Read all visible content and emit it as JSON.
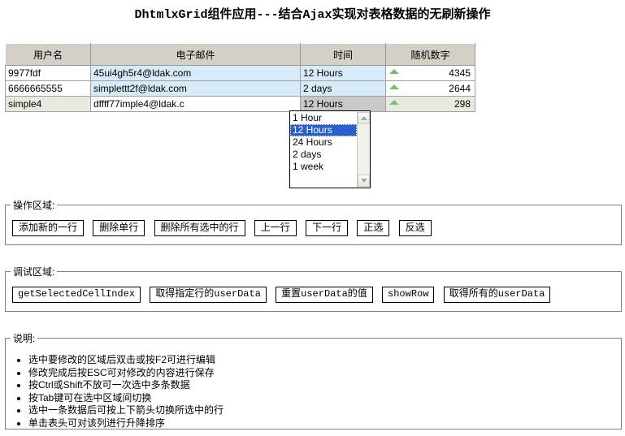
{
  "page": {
    "title": "DhtmlxGrid组件应用---结合Ajax实现对表格数据的无刷新操作"
  },
  "grid": {
    "columns": [
      "用户名",
      "电子邮件",
      "时间",
      "随机数字"
    ],
    "rows": [
      {
        "user": "9977fdf",
        "email": "45ui4gh5r4@ldak.com",
        "time": "12 Hours",
        "number": "4345",
        "sort_icon": "up-arrow-icon",
        "state": "blue"
      },
      {
        "user": "6666665555",
        "email": "simplettt2f@ldak.com",
        "time": "2 days",
        "number": "2644",
        "sort_icon": "up-arrow-icon",
        "state": "blue"
      },
      {
        "user": "simple4",
        "email": "dffff77imple4@ldak.c",
        "time": "12 Hours",
        "number": "298",
        "sort_icon": "up-arrow-icon",
        "state": "selected"
      }
    ]
  },
  "dropdown": {
    "options": [
      "1 Hour",
      "12 Hours",
      "24 Hours",
      "2 days",
      "1 week"
    ],
    "selected": "12 Hours",
    "scroll_up_icon": "chevron-up-icon",
    "scroll_down_icon": "chevron-down-icon"
  },
  "operations": {
    "legend": "操作区域:",
    "buttons": [
      "添加新的一行",
      "删除单行",
      "删除所有选中的行",
      "上一行",
      "下一行",
      "正选",
      "反选"
    ]
  },
  "debug": {
    "legend": "调试区域:",
    "buttons": [
      "getSelectedCellIndex",
      "取得指定行的userData",
      "重置userData的值",
      "showRow",
      "取得所有的userData"
    ]
  },
  "help": {
    "legend": "说明:",
    "items": [
      "选中要修改的区域后双击或按F2可进行编辑",
      "修改完成后按ESC可对修改的内容进行保存",
      "按Ctrl或Shift不放可一次选中多条数据",
      "按Tab键可在选中区域间切换",
      "选中一条数据后可按上下箭头切换所选中的行",
      "单击表头可对该列进行升降排序"
    ]
  },
  "colors": {
    "header_bg": "#d4d0c8",
    "row_blue": "#d6ebf7",
    "row_selected": "#e9e9e0",
    "active_cell": "#c8c8c8",
    "number_text": "#1a7a1a",
    "dropdown_selected": "#2a5fcc"
  }
}
